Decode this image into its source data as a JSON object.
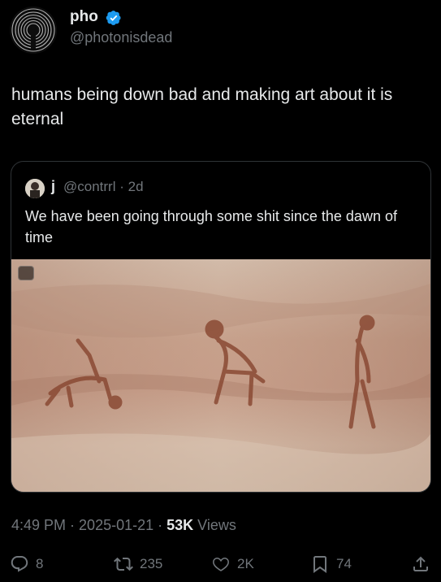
{
  "author": {
    "display_name": "pho",
    "handle": "@photonisdead",
    "verified": true
  },
  "tweet": {
    "text": "humans being down bad and making art about it is eternal"
  },
  "quote": {
    "display_name": "j",
    "handle": "@contrrl",
    "age": "2d",
    "text": "We have been going through some shit since the dawn of time"
  },
  "meta": {
    "time": "4:49 PM",
    "date": "2025-01-21",
    "views_count": "53K",
    "views_label": "Views"
  },
  "actions": {
    "replies": "8",
    "reposts": "235",
    "likes": "2K",
    "bookmarks": "74"
  },
  "colors": {
    "background": "#000000",
    "text": "#e7e9ea",
    "secondary": "#71767b",
    "verified": "#1d9bf0",
    "border": "#2f3336"
  }
}
